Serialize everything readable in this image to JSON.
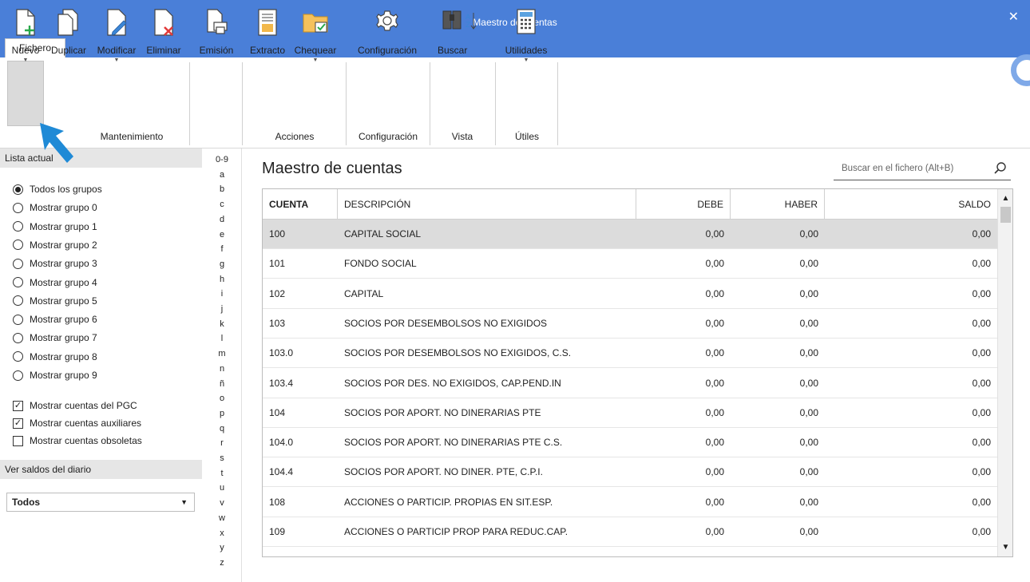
{
  "window": {
    "title": "Maestro de cuentas",
    "close_glyph": "✕"
  },
  "tabs": [
    {
      "label": "Fichero"
    }
  ],
  "ribbon": {
    "buttons": {
      "nuevo": "Nuevo",
      "duplicar": "Duplicar",
      "modificar": "Modificar",
      "eliminar": "Eliminar",
      "emision": "Emisión",
      "extracto": "Extracto",
      "chequear": "Chequear",
      "configuracion": "Configuración",
      "buscar": "Buscar",
      "utilidades": "Utilidades"
    },
    "groups": {
      "mantenimiento": "Mantenimiento",
      "acciones": "Acciones",
      "configuracion": "Configuración",
      "vista": "Vista",
      "utiles": "Útiles"
    },
    "dropdown_glyph": "▼"
  },
  "sidebar": {
    "list_header": "Lista actual",
    "groups": [
      {
        "label": "Todos los grupos",
        "selected": true
      },
      {
        "label": "Mostrar grupo 0",
        "selected": false
      },
      {
        "label": "Mostrar grupo 1",
        "selected": false
      },
      {
        "label": "Mostrar grupo 2",
        "selected": false
      },
      {
        "label": "Mostrar grupo 3",
        "selected": false
      },
      {
        "label": "Mostrar grupo 4",
        "selected": false
      },
      {
        "label": "Mostrar grupo 5",
        "selected": false
      },
      {
        "label": "Mostrar grupo 6",
        "selected": false
      },
      {
        "label": "Mostrar grupo 7",
        "selected": false
      },
      {
        "label": "Mostrar grupo 8",
        "selected": false
      },
      {
        "label": "Mostrar grupo 9",
        "selected": false
      }
    ],
    "checks": [
      {
        "label": "Mostrar cuentas del PGC",
        "checked": true
      },
      {
        "label": "Mostrar cuentas auxiliares",
        "checked": true
      },
      {
        "label": "Mostrar cuentas obsoletas",
        "checked": false
      }
    ],
    "saldos_header": "Ver saldos del diario",
    "saldos_value": "Todos"
  },
  "alphabet": [
    "0-9",
    "a",
    "b",
    "c",
    "d",
    "e",
    "f",
    "g",
    "h",
    "i",
    "j",
    "k",
    "l",
    "m",
    "n",
    "ñ",
    "o",
    "p",
    "q",
    "r",
    "s",
    "t",
    "u",
    "v",
    "w",
    "x",
    "y",
    "z"
  ],
  "main": {
    "title": "Maestro de cuentas",
    "search_placeholder": "Buscar en el fichero (Alt+B)"
  },
  "table": {
    "columns": [
      "CUENTA",
      "DESCRIPCIÓN",
      "DEBE",
      "HABER",
      "SALDO"
    ],
    "rows": [
      [
        "100",
        "CAPITAL SOCIAL",
        "0,00",
        "0,00",
        "0,00"
      ],
      [
        "101",
        "FONDO SOCIAL",
        "0,00",
        "0,00",
        "0,00"
      ],
      [
        "102",
        "CAPITAL",
        "0,00",
        "0,00",
        "0,00"
      ],
      [
        "103",
        "SOCIOS POR DESEMBOLSOS NO EXIGIDOS",
        "0,00",
        "0,00",
        "0,00"
      ],
      [
        "103.0",
        "SOCIOS POR DESEMBOLSOS NO EXIGIDOS, C.S.",
        "0,00",
        "0,00",
        "0,00"
      ],
      [
        "103.4",
        "SOCIOS POR DES. NO EXIGIDOS, CAP.PEND.IN",
        "0,00",
        "0,00",
        "0,00"
      ],
      [
        "104",
        "SOCIOS POR APORT. NO DINERARIAS PTE",
        "0,00",
        "0,00",
        "0,00"
      ],
      [
        "104.0",
        "SOCIOS POR APORT. NO DINERARIAS PTE C.S.",
        "0,00",
        "0,00",
        "0,00"
      ],
      [
        "104.4",
        "SOCIOS POR APORT. NO DINER. PTE, C.P.I.",
        "0,00",
        "0,00",
        "0,00"
      ],
      [
        "108",
        "ACCIONES O PARTICIP. PROPIAS EN SIT.ESP.",
        "0,00",
        "0,00",
        "0,00"
      ],
      [
        "109",
        "ACCIONES O PARTICIP PROP PARA REDUC.CAP.",
        "0,00",
        "0,00",
        "0,00"
      ]
    ],
    "selected_row": 0
  },
  "colors": {
    "accent": "#4a7fd8",
    "pointer": "#1f8ad6"
  }
}
